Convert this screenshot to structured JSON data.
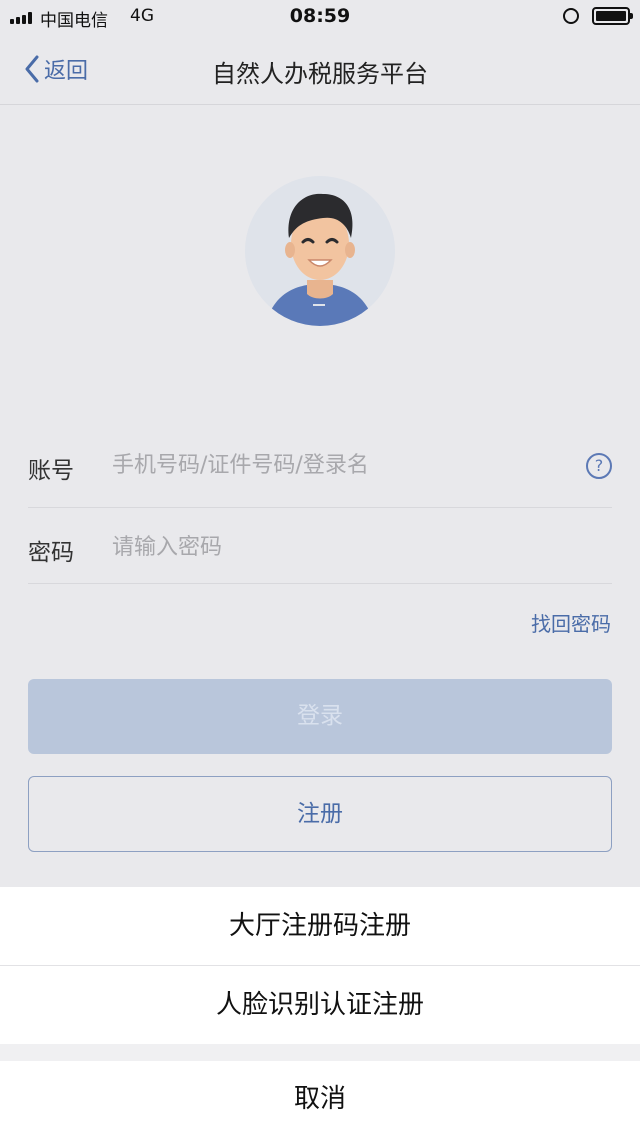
{
  "status_bar": {
    "carrier": "中国电信",
    "network": "4G",
    "time": "08:59"
  },
  "nav": {
    "back_label": "返回",
    "title": "自然人办税服务平台"
  },
  "form": {
    "account_label": "账号",
    "account_placeholder": "手机号码/证件号码/登录名",
    "password_label": "密码",
    "password_placeholder": "请输入密码",
    "forgot_password": "找回密码",
    "help_icon": "?"
  },
  "buttons": {
    "login": "登录",
    "register": "注册"
  },
  "action_sheet": {
    "options": [
      "大厅注册码注册",
      "人脸识别认证注册"
    ],
    "cancel": "取消"
  },
  "colors": {
    "accent": "#4a6ca8",
    "login_disabled": "#b9c6db",
    "background": "#e9e9ec"
  }
}
